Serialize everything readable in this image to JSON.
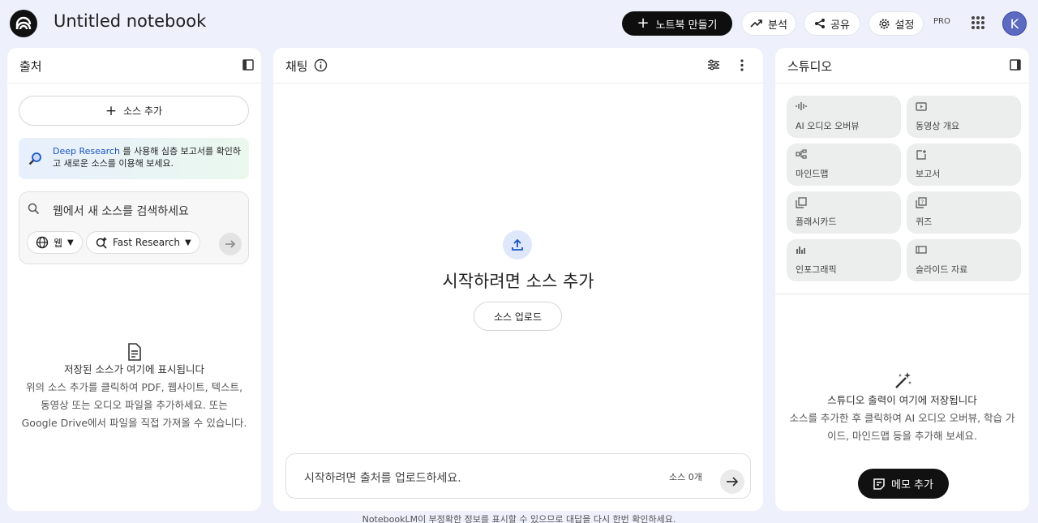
{
  "header": {
    "title": "Untitled notebook",
    "create_label": "노트북 만들기",
    "analytics_label": "분석",
    "share_label": "공유",
    "settings_label": "설정",
    "pro_badge": "PRO",
    "avatar_initial": "K"
  },
  "sources": {
    "title": "출처",
    "add_label": "소스 추가",
    "deep_link": "Deep Research",
    "deep_text": " 를 사용해 심층 보고서를 확인하고 새로운 소스를 이용해 보세요.",
    "search_placeholder": "웹에서 새 소스를 검색하세요",
    "web_chip": "웹",
    "research_chip": "Fast Research",
    "empty_title": "저장된 소스가 여기에 표시됩니다",
    "empty_line1": "위의 소스 추가를 클릭하여 PDF, 웹사이트, 텍스트,",
    "empty_line2": "동영상 또는 오디오 파일을 추가하세요. 또는",
    "empty_line3": "Google Drive에서 파일을 직접 가져올 수 있습니다."
  },
  "chat": {
    "title": "채팅",
    "start_title": "시작하려면 소스 추가",
    "upload_label": "소스 업로드",
    "input_placeholder": "시작하려면 출처를 업로드하세요.",
    "source_count": "소스 0개"
  },
  "studio": {
    "title": "스튜디오",
    "tiles": [
      {
        "label": "AI 오디오 오버뷰",
        "icon": "audio-icon"
      },
      {
        "label": "동영상 개요",
        "icon": "video-icon"
      },
      {
        "label": "마인드맵",
        "icon": "mindmap-icon"
      },
      {
        "label": "보고서",
        "icon": "report-icon"
      },
      {
        "label": "플래시카드",
        "icon": "flashcard-icon"
      },
      {
        "label": "퀴즈",
        "icon": "quiz-icon"
      },
      {
        "label": "인포그래픽",
        "icon": "infographic-icon"
      },
      {
        "label": "슬라이드 자료",
        "icon": "slides-icon"
      }
    ],
    "empty_title": "스튜디오 출력이 여기에 저장됩니다",
    "empty_line1": "소스를 추가한 후 클릭하여 AI 오디오 오버뷰, 학습 가",
    "empty_line2": "이드, 마인드맵 등을 추가해 보세요.",
    "memo_label": "메모 추가"
  },
  "footer": "NotebookLM이 부정확한 정보를 표시할 수 있으므로 대답을 다시 한번 확인하세요."
}
